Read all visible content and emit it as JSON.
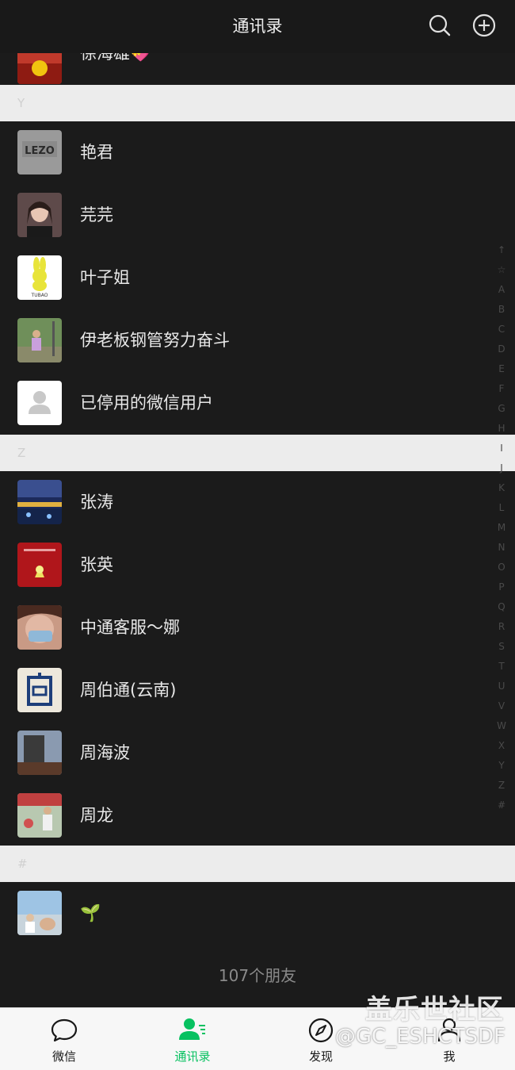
{
  "header": {
    "title": "通讯录"
  },
  "contacts_top": {
    "partial_name": "徐海雄💝"
  },
  "sections": [
    {
      "letter": "Y",
      "contacts": [
        "艳君",
        "芫芫",
        "叶子姐",
        "伊老板钢管努力奋斗",
        "已停用的微信用户"
      ]
    },
    {
      "letter": "Z",
      "contacts": [
        "张涛",
        "张英",
        "中通客服～娜",
        "周伯通(云南)",
        "周海波",
        "周龙"
      ]
    },
    {
      "letter": "#",
      "contacts": [
        "🌱"
      ]
    }
  ],
  "footer": {
    "friend_count": "107个朋友"
  },
  "index_bar": [
    "↑",
    "☆",
    "A",
    "B",
    "C",
    "D",
    "E",
    "F",
    "G",
    "H",
    "I",
    "J",
    "K",
    "L",
    "M",
    "N",
    "O",
    "P",
    "Q",
    "R",
    "S",
    "T",
    "U",
    "V",
    "W",
    "X",
    "Y",
    "Z",
    "#"
  ],
  "tabs": [
    {
      "label": "微信",
      "active": false
    },
    {
      "label": "通讯录",
      "active": true
    },
    {
      "label": "发现",
      "active": false
    },
    {
      "label": "我",
      "active": false
    }
  ],
  "watermark": {
    "line1": "盖乐世社区",
    "line2": "@GC_ESHCTSDF"
  },
  "colors": {
    "accent": "#07c160",
    "background": "#1b1b1b",
    "section": "#ececec"
  }
}
